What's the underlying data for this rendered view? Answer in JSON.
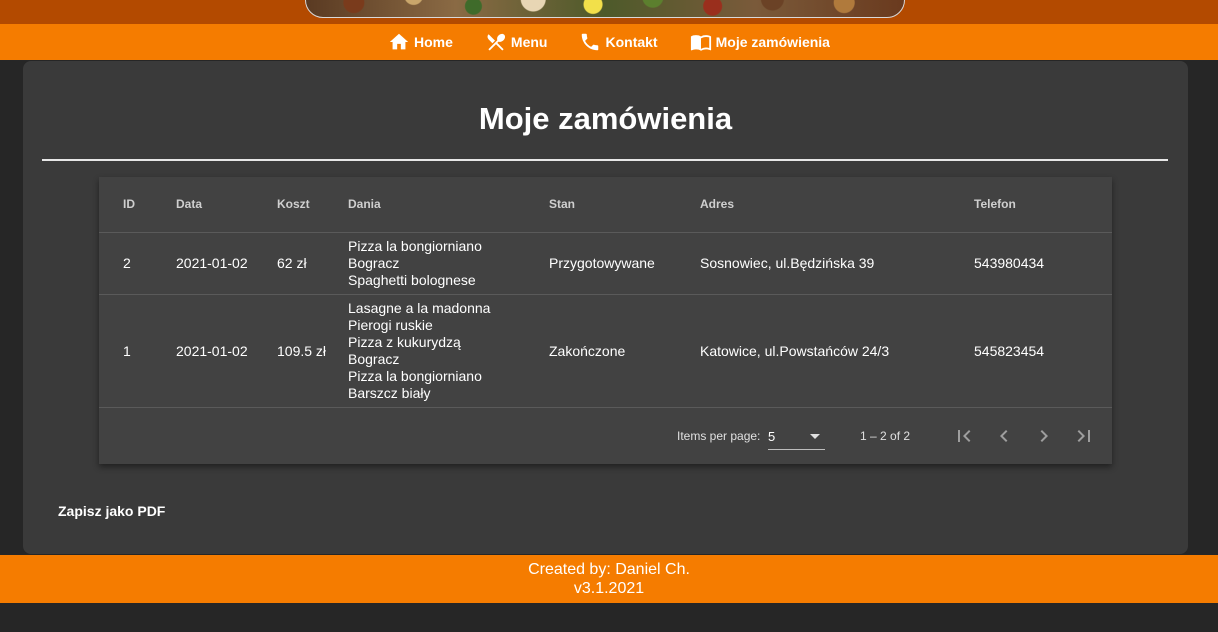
{
  "nav": {
    "items": [
      {
        "label": "Home",
        "icon": "home-icon"
      },
      {
        "label": "Menu",
        "icon": "utensils-icon"
      },
      {
        "label": "Kontakt",
        "icon": "phone-icon"
      },
      {
        "label": "Moje zamówienia",
        "icon": "book-icon"
      }
    ]
  },
  "page": {
    "title": "Moje zamówienia"
  },
  "table": {
    "headers": [
      "ID",
      "Data",
      "Koszt",
      "Dania",
      "Stan",
      "Adres",
      "Telefon"
    ],
    "rows": [
      {
        "id": "2",
        "data": "2021-01-02",
        "koszt": "62 zł",
        "dania": [
          "Pizza la bongiorniano",
          "Bogracz",
          "Spaghetti bolognese"
        ],
        "stan": "Przygotowywane",
        "adres": "Sosnowiec, ul.Będzińska 39",
        "telefon": "543980434"
      },
      {
        "id": "1",
        "data": "2021-01-02",
        "koszt": "109.5 zł",
        "dania": [
          "Lasagne a la madonna",
          "Pierogi ruskie",
          "Pizza z kukurydzą",
          "Bogracz",
          "Pizza la bongiorniano",
          "Barszcz biały"
        ],
        "stan": "Zakończone",
        "adres": "Katowice, ul.Powstańców 24/3",
        "telefon": "545823454"
      }
    ]
  },
  "paginator": {
    "items_per_page_label": "Items per page:",
    "page_size": "5",
    "range": "1 – 2 of 2"
  },
  "actions": {
    "save_pdf": "Zapisz jako PDF"
  },
  "footer": {
    "created_by": "Created by: Daniel Ch.",
    "version": "v3.1.2021"
  },
  "colors": {
    "accent": "#f57c00",
    "banner": "#b34a00",
    "background": "#262626",
    "card": "#3a3a3a",
    "table": "#424242"
  }
}
